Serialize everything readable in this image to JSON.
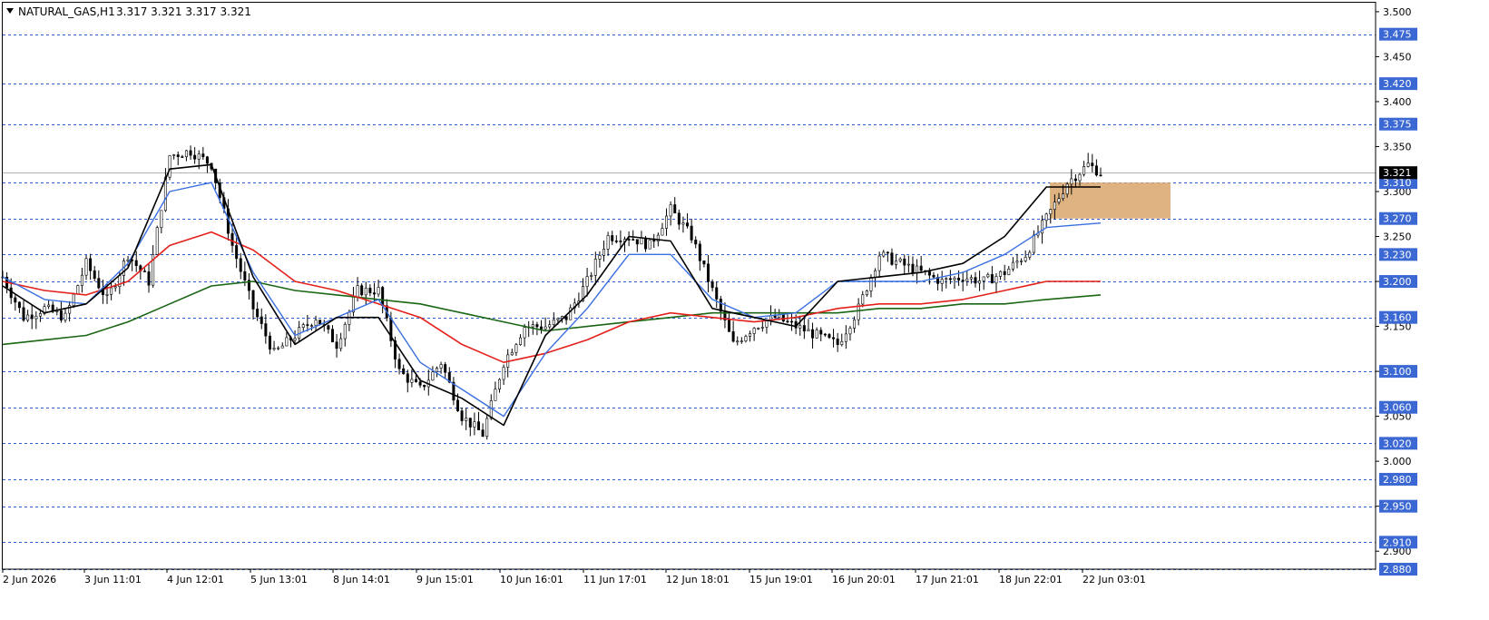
{
  "header": {
    "symbol_label": "NATURAL_GAS,H1",
    "ohlc_label": "3.317 3.321 3.317 3.321"
  },
  "colors": {
    "background": "#ffffff",
    "frame": "#000000",
    "level_line": "#2d5fcf",
    "level_badge": "#3c68d4",
    "price_badge": "#000000",
    "ema_fast": "#000000",
    "ema_mid": "#3a6fe0",
    "ema_slow": "#e3201b",
    "ema_long": "#1a6614",
    "zone": "#d9a66b"
  },
  "chart_data": {
    "type": "line",
    "title": "NATURAL_GAS,H1",
    "timeframe": "H1",
    "ohlc_last": {
      "open": 3.317,
      "high": 3.321,
      "low": 3.317,
      "close": 3.321
    },
    "last_price": 3.321,
    "ylim": [
      2.88,
      3.51
    ],
    "y_tick_labels": [
      "3.500",
      "3.450",
      "3.400",
      "3.350",
      "3.300",
      "3.250",
      "3.200",
      "3.150",
      "3.100",
      "3.050",
      "3.000",
      "2.950",
      "2.900"
    ],
    "x_tick_labels": [
      "2 Jun 2026",
      "3 Jun 11:01",
      "4 Jun 12:01",
      "5 Jun 13:01",
      "8 Jun 14:01",
      "9 Jun 15:01",
      "10 Jun 16:01",
      "11 Jun 17:01",
      "12 Jun 18:01",
      "15 Jun 19:01",
      "16 Jun 20:01",
      "17 Jun 21:01",
      "18 Jun 22:01",
      "22 Jun 03:01"
    ],
    "horizontal_levels": [
      "3.475",
      "3.420",
      "3.375",
      "3.310",
      "3.270",
      "3.230",
      "3.200",
      "3.160",
      "3.100",
      "3.060",
      "3.020",
      "2.980",
      "2.950",
      "2.910",
      "2.880"
    ],
    "zone": {
      "from": "22 Jun 03:01",
      "price_top": 3.31,
      "price_bottom": 3.27
    },
    "grid": false,
    "series": [
      {
        "kind": "price",
        "x": [
          0,
          5,
          10,
          15,
          20,
          25,
          30,
          35,
          40,
          45,
          50,
          55,
          60,
          65,
          70,
          75,
          80,
          85,
          90,
          95,
          100,
          105,
          110,
          115,
          120,
          125,
          130
        ],
        "values": [
          3.205,
          3.16,
          3.17,
          3.16,
          3.22,
          3.18,
          3.23,
          3.2,
          3.34,
          3.345,
          3.33,
          3.24,
          3.17,
          3.12,
          3.14,
          3.16,
          3.13,
          3.19,
          3.19,
          3.1,
          3.08,
          3.11,
          3.05,
          3.03,
          3.11,
          3.15,
          3.15
        ]
      },
      {
        "kind": "price",
        "x": [
          135,
          140,
          145,
          150,
          155,
          160,
          165,
          170,
          175,
          180,
          185,
          190,
          195,
          200,
          205,
          210,
          215,
          220,
          225,
          230,
          235,
          240,
          245,
          250,
          255,
          260,
          263
        ],
        "values": [
          3.16,
          3.2,
          3.25,
          3.25,
          3.24,
          3.28,
          3.25,
          3.19,
          3.13,
          3.15,
          3.16,
          3.15,
          3.14,
          3.13,
          3.17,
          3.23,
          3.22,
          3.21,
          3.2,
          3.205,
          3.2,
          3.21,
          3.23,
          3.27,
          3.31,
          3.33,
          3.321
        ]
      },
      {
        "kind": "moving_average_fast",
        "x": [
          0,
          10,
          20,
          30,
          40,
          50,
          60,
          70,
          80,
          90,
          100,
          110,
          120,
          130,
          140,
          150,
          160,
          170,
          180,
          190,
          200,
          210,
          220,
          230,
          240,
          250,
          263
        ],
        "values": [
          3.195,
          3.165,
          3.175,
          3.215,
          3.325,
          3.33,
          3.205,
          3.13,
          3.16,
          3.16,
          3.09,
          3.07,
          3.04,
          3.14,
          3.185,
          3.25,
          3.245,
          3.17,
          3.16,
          3.15,
          3.2,
          3.205,
          3.21,
          3.22,
          3.25,
          3.305,
          3.305
        ]
      },
      {
        "kind": "moving_average_mid",
        "x": [
          0,
          10,
          20,
          30,
          40,
          50,
          60,
          70,
          80,
          90,
          100,
          110,
          120,
          130,
          140,
          150,
          160,
          170,
          180,
          190,
          200,
          210,
          220,
          230,
          240,
          250,
          263
        ],
        "values": [
          3.205,
          3.18,
          3.175,
          3.22,
          3.3,
          3.31,
          3.21,
          3.14,
          3.16,
          3.18,
          3.11,
          3.08,
          3.05,
          3.12,
          3.17,
          3.23,
          3.23,
          3.18,
          3.16,
          3.165,
          3.2,
          3.2,
          3.2,
          3.21,
          3.23,
          3.26,
          3.265
        ]
      },
      {
        "kind": "moving_average_slow",
        "x": [
          0,
          10,
          20,
          30,
          40,
          50,
          60,
          70,
          80,
          90,
          100,
          110,
          120,
          130,
          140,
          150,
          160,
          170,
          180,
          190,
          200,
          210,
          220,
          230,
          240,
          250,
          263
        ],
        "values": [
          3.2,
          3.19,
          3.185,
          3.2,
          3.24,
          3.255,
          3.235,
          3.2,
          3.19,
          3.175,
          3.16,
          3.13,
          3.11,
          3.12,
          3.135,
          3.155,
          3.165,
          3.16,
          3.155,
          3.16,
          3.17,
          3.175,
          3.175,
          3.18,
          3.19,
          3.2,
          3.2
        ]
      },
      {
        "kind": "moving_average_long",
        "x": [
          0,
          10,
          20,
          30,
          40,
          50,
          60,
          70,
          80,
          90,
          100,
          110,
          120,
          130,
          140,
          150,
          160,
          170,
          180,
          190,
          200,
          210,
          220,
          230,
          240,
          250,
          263
        ],
        "values": [
          3.13,
          3.135,
          3.14,
          3.155,
          3.175,
          3.195,
          3.2,
          3.19,
          3.185,
          3.18,
          3.175,
          3.165,
          3.155,
          3.145,
          3.15,
          3.155,
          3.16,
          3.165,
          3.165,
          3.165,
          3.165,
          3.17,
          3.17,
          3.175,
          3.175,
          3.18,
          3.185
        ]
      }
    ]
  }
}
